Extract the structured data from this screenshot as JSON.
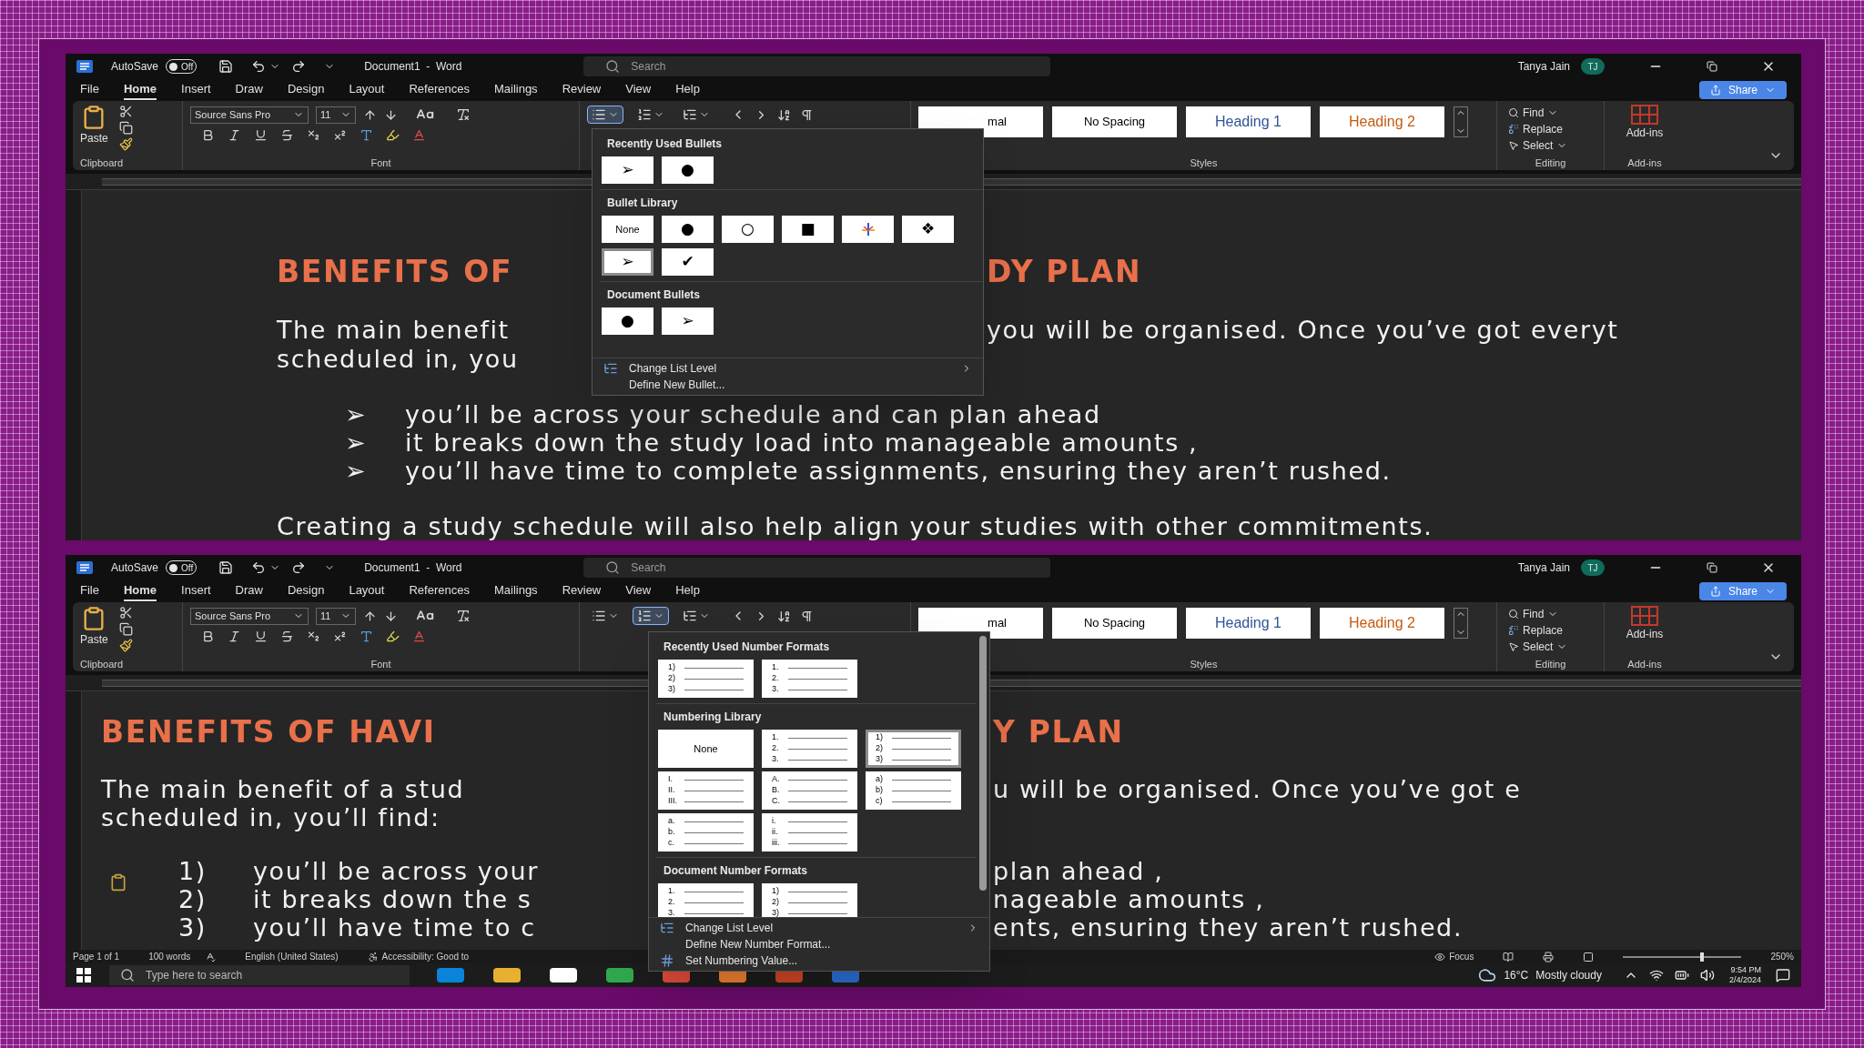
{
  "windows": [
    {
      "title_bar": {
        "autosave_label": "AutoSave",
        "autosave_state": "Off",
        "autosave_on": false,
        "document_title": "Document1  -  Word",
        "search_placeholder": "Search",
        "user_name": "Tanya Jain",
        "user_initials": "TJ"
      },
      "share": "Share",
      "menu_tabs": [
        {
          "label": "File",
          "selected": false
        },
        {
          "label": "Home",
          "selected": true
        },
        {
          "label": "Insert",
          "selected": false
        },
        {
          "label": "Draw",
          "selected": false
        },
        {
          "label": "Design",
          "selected": false
        },
        {
          "label": "Layout",
          "selected": false
        },
        {
          "label": "References",
          "selected": false
        },
        {
          "label": "Mailings",
          "selected": false
        },
        {
          "label": "Review",
          "selected": false
        },
        {
          "label": "View",
          "selected": false
        },
        {
          "label": "Help",
          "selected": false
        }
      ],
      "ribbon": {
        "paste": "Paste",
        "font_name": "Source Sans Pro",
        "font_size": "11",
        "list_buttons": [
          {
            "kind": "bullets",
            "selected": true
          },
          {
            "kind": "numbering",
            "selected": false
          },
          {
            "kind": "multilevel",
            "selected": false
          }
        ],
        "styles": [
          {
            "label": "mal",
            "kind": "normal"
          },
          {
            "label": "No Spacing",
            "kind": "plain"
          },
          {
            "label": "Heading 1",
            "kind": "heading1"
          },
          {
            "label": "Heading 2",
            "kind": "heading2"
          }
        ],
        "find": "Find",
        "replace": "Replace",
        "select": "Select",
        "addins": "Add-ins",
        "group_labels": {
          "clipboard": "Clipboard",
          "font": "Font",
          "styles": "Styles",
          "editing": "Editing",
          "addins": "Add-ins"
        }
      },
      "document": {
        "heading": {
          "left": "BENEFITS OF",
          "right": "DY PLAN"
        },
        "paragraph": [
          {
            "left": "The main benefit",
            "right": "you will be organised. Once you’ve got everyt"
          },
          {
            "left": "scheduled in, you"
          }
        ],
        "list": [
          {
            "marker": "➢",
            "left": "you’ll be across your schedule and can plan ahead"
          },
          {
            "marker": "➢",
            "left": "it breaks down the study load into manageable amounts ,"
          },
          {
            "marker": "➢",
            "left": "you’ll have time to complete assignments, ensuring they aren’t rushed."
          }
        ],
        "closing": "Creating a study schedule will also help align your studies with other commitments."
      },
      "list_menu": {
        "kind": "bullets",
        "sections": [
          {
            "title": "Recently Used Bullets",
            "items": [
              {
                "kind": "glyph",
                "glyph": "➢",
                "selected": false
              },
              {
                "kind": "glyph",
                "glyph": "●",
                "selected": false
              }
            ]
          },
          {
            "title": "Bullet Library",
            "items": [
              {
                "kind": "none",
                "label": "None",
                "selected": false
              },
              {
                "kind": "glyph",
                "glyph": "●",
                "selected": false
              },
              {
                "kind": "glyph",
                "glyph": "○",
                "selected": false
              },
              {
                "kind": "glyph",
                "glyph": "■",
                "selected": false
              },
              {
                "kind": "picture",
                "selected": false
              },
              {
                "kind": "glyph",
                "glyph": "❖",
                "selected": false
              },
              {
                "kind": "glyph",
                "glyph": "➢",
                "selected": true
              },
              {
                "kind": "glyph",
                "glyph": "✔",
                "selected": false
              }
            ]
          },
          {
            "title": "Document Bullets",
            "items": [
              {
                "kind": "glyph",
                "glyph": "●",
                "selected": false
              },
              {
                "kind": "glyph",
                "glyph": "➢",
                "selected": false
              }
            ]
          }
        ],
        "commands": [
          {
            "label": "Change List Level",
            "kind": "list-level",
            "submenu": true
          },
          {
            "label": "Define New Bullet...",
            "kind": "plain",
            "submenu": false
          }
        ]
      }
    },
    {
      "title_bar": {
        "autosave_label": "AutoSave",
        "autosave_state": "Off",
        "autosave_on": false,
        "document_title": "Document1  -  Word",
        "search_placeholder": "Search",
        "user_name": "Tanya Jain",
        "user_initials": "TJ"
      },
      "share": "Share",
      "menu_tabs": [
        {
          "label": "File",
          "selected": false
        },
        {
          "label": "Home",
          "selected": true
        },
        {
          "label": "Insert",
          "selected": false
        },
        {
          "label": "Draw",
          "selected": false
        },
        {
          "label": "Design",
          "selected": false
        },
        {
          "label": "Layout",
          "selected": false
        },
        {
          "label": "References",
          "selected": false
        },
        {
          "label": "Mailings",
          "selected": false
        },
        {
          "label": "Review",
          "selected": false
        },
        {
          "label": "View",
          "selected": false
        },
        {
          "label": "Help",
          "selected": false
        }
      ],
      "ribbon": {
        "paste": "Paste",
        "font_name": "Source Sans Pro",
        "font_size": "11",
        "list_buttons": [
          {
            "kind": "bullets",
            "selected": false
          },
          {
            "kind": "numbering",
            "selected": true
          },
          {
            "kind": "multilevel",
            "selected": false
          }
        ],
        "styles": [
          {
            "label": "mal",
            "kind": "normal"
          },
          {
            "label": "No Spacing",
            "kind": "plain"
          },
          {
            "label": "Heading 1",
            "kind": "heading1"
          },
          {
            "label": "Heading 2",
            "kind": "heading2"
          }
        ],
        "find": "Find",
        "replace": "Replace",
        "select": "Select",
        "addins": "Add-ins",
        "group_labels": {
          "clipboard": "Clipboard",
          "font": "Font",
          "styles": "Styles",
          "editing": "Editing",
          "addins": "Add-ins"
        }
      },
      "document": {
        "heading": {
          "left": "BENEFITS OF HAVI",
          "right": "Y PLAN"
        },
        "paragraph": [
          {
            "left": "The main benefit of a stud",
            "right": "u will be organised. Once you’ve got e"
          },
          {
            "left": "scheduled in, you’ll find:"
          }
        ],
        "list": [
          {
            "marker": "1)",
            "left": "you’ll be across your",
            "right": "plan ahead ,"
          },
          {
            "marker": "2)",
            "left": "it breaks down the s",
            "right": "nageable amounts ,"
          },
          {
            "marker": "3)",
            "left": "you’ll have time to c",
            "right": "ents, ensuring they aren’t rushed."
          }
        ],
        "paste_options": true
      },
      "status_bar": {
        "page": "Page 1 of 1",
        "words": "100 words",
        "language": "English (United States)",
        "accessibility": "Accessibility: Good to",
        "focus": "Focus",
        "zoom": "250%",
        "zoom_slider": {
          "level": 0.65
        }
      },
      "list_menu": {
        "kind": "numbering",
        "sections": [
          {
            "title": "Recently Used Number Formats",
            "items": [
              {
                "kind": "numbers",
                "lines": [
                  "1)",
                  "2)",
                  "3)"
                ],
                "selected": false
              },
              {
                "kind": "numbers",
                "lines": [
                  "1.",
                  "2.",
                  "3."
                ],
                "selected": false
              }
            ]
          },
          {
            "title": "Numbering Library",
            "items": [
              {
                "kind": "none",
                "label": "None",
                "selected": false
              },
              {
                "kind": "numbers",
                "lines": [
                  "1.",
                  "2.",
                  "3."
                ],
                "selected": false
              },
              {
                "kind": "numbers",
                "lines": [
                  "1)",
                  "2)",
                  "3)"
                ],
                "selected": true
              },
              {
                "kind": "numbers",
                "lines": [
                  "I.",
                  "II.",
                  "III."
                ],
                "selected": false
              },
              {
                "kind": "numbers",
                "lines": [
                  "A.",
                  "B.",
                  "C."
                ],
                "selected": false
              },
              {
                "kind": "numbers",
                "lines": [
                  "a)",
                  "b)",
                  "c)"
                ],
                "selected": false
              },
              {
                "kind": "numbers",
                "lines": [
                  "a.",
                  "b.",
                  "c."
                ],
                "selected": false
              },
              {
                "kind": "numbers",
                "lines": [
                  "i.",
                  "ii.",
                  "iii."
                ],
                "selected": false
              }
            ]
          },
          {
            "title": "Document Number Formats",
            "items": [
              {
                "kind": "numbers",
                "lines": [
                  "1.",
                  "2.",
                  "3."
                ],
                "selected": false
              },
              {
                "kind": "numbers",
                "lines": [
                  "1)",
                  "2)",
                  "3)"
                ],
                "selected": false
              }
            ]
          }
        ],
        "commands": [
          {
            "label": "Change List Level",
            "kind": "list-level",
            "submenu": true
          },
          {
            "label": "Define New Number Format...",
            "kind": "plain",
            "submenu": false
          },
          {
            "label": "Set Numbering Value...",
            "kind": "numbering-value",
            "submenu": false
          }
        ]
      }
    }
  ],
  "taskbar": {
    "search_placeholder": "Type here to search",
    "temperature": "16°C",
    "weather": "Mostly cloudy",
    "time": "9:54 PM",
    "date": "2/4/2024"
  }
}
